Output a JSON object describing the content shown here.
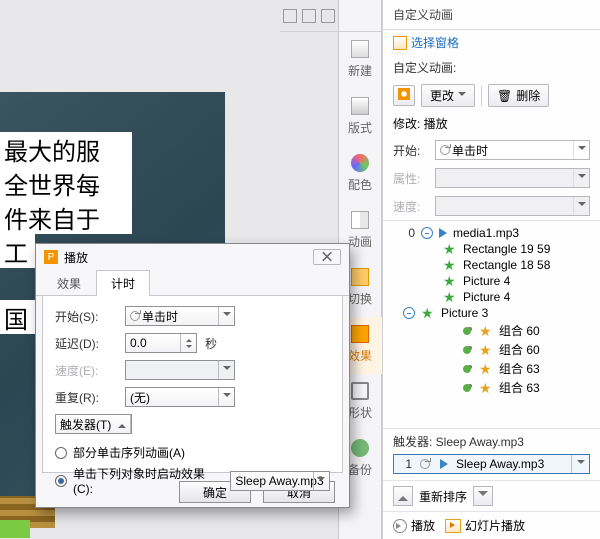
{
  "slide_text": {
    "l1": "最大的服",
    "l2": "全世界每",
    "l3": "件来自于",
    "l4": "工",
    "l5": "国"
  },
  "midbar": {
    "new": "新建",
    "layout": "版式",
    "color": "配色",
    "anim": "动画",
    "switch": "切换",
    "fx": "效果",
    "shape": "形状",
    "backup": "备份"
  },
  "panel": {
    "title": "自定义动画",
    "select_pane": "选择窗格",
    "custom_anim_label": "自定义动画:",
    "change": "更改",
    "delete": "删除",
    "modify_label": "修改: 播放",
    "start_label": "开始:",
    "start_value": "单击时",
    "prop_label": "属性:",
    "speed_label": "速度:",
    "trigger_label": "触发器: Sleep Away.mp3",
    "trig_item": "Sleep Away.mp3",
    "reorder": "重新排序",
    "play": "播放",
    "slideshow": "幻灯片播放"
  },
  "anim_items": [
    {
      "num": "0",
      "clock": true,
      "tri": true,
      "name": "media1.mp3",
      "lvl": 1
    },
    {
      "star": "green",
      "name": "Rectangle 19 59",
      "lvl": 2
    },
    {
      "star": "green",
      "name": "Rectangle 18 58",
      "lvl": 2
    },
    {
      "star": "green",
      "name": "Picture 4",
      "lvl": 2
    },
    {
      "star": "green",
      "name": "Picture 4",
      "lvl": 2
    },
    {
      "clock": true,
      "star": "green",
      "name": "Picture 3",
      "lvl": 1
    },
    {
      "pin": true,
      "star": "amber",
      "name": "组合 60",
      "lvl": 3
    },
    {
      "pin": true,
      "star": "amber",
      "name": "组合 60",
      "lvl": 3
    },
    {
      "pin": true,
      "star": "amber",
      "name": "组合 63",
      "lvl": 3
    },
    {
      "pin": true,
      "star": "amber",
      "name": "组合 63",
      "lvl": 3
    }
  ],
  "dialog": {
    "title": "播放",
    "close": "⨉",
    "tab_effect": "效果",
    "tab_timing": "计时",
    "start_label": "开始(S):",
    "start_value": "单击时",
    "delay_label": "延迟(D):",
    "delay_value": "0.0",
    "sec": "秒",
    "speed_label": "速度(E):",
    "repeat_label": "重复(R):",
    "repeat_value": "(无)",
    "trigger_btn": "触发器(T)",
    "radio_a": "部分单击序列动画(A)",
    "radio_b": "单击下列对象时启动效果(C):",
    "radio_b_val": "Sleep Away.mp3",
    "ok": "确定",
    "cancel": "取消"
  }
}
